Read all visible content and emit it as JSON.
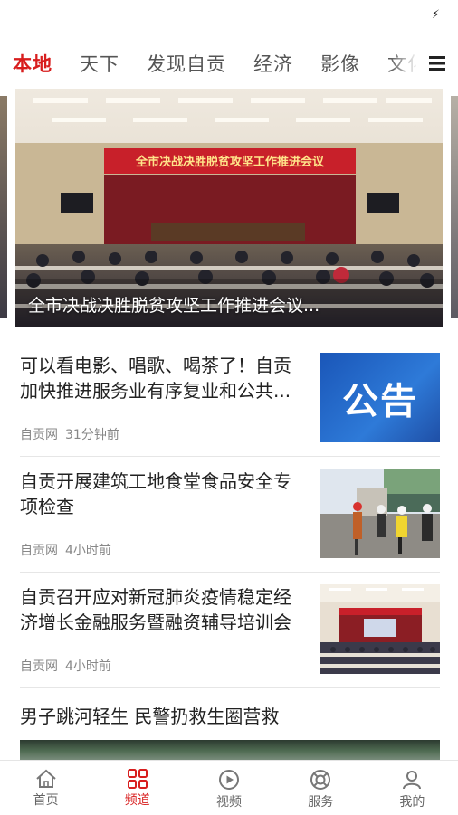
{
  "status_bar": {
    "charging_icon": "lightning-bolt-icon"
  },
  "tabs": {
    "items": [
      {
        "label": "本地",
        "active": true
      },
      {
        "label": "天下",
        "active": false
      },
      {
        "label": "发现自贡",
        "active": false
      },
      {
        "label": "经济",
        "active": false
      },
      {
        "label": "影像",
        "active": false
      },
      {
        "label": "文化",
        "active": false
      }
    ],
    "menu_icon": "hamburger-menu-icon",
    "accent_color": "#d81e1e"
  },
  "banner": {
    "caption": "全市决战决胜脱贫攻坚工作推进会议...",
    "stage_sign": "全市决战决胜脱贫攻坚工作推进会议"
  },
  "news": [
    {
      "title": "可以看电影、唱歌、喝茶了！自贡加快推进服务业有序复业和公共...",
      "source": "自贡网",
      "time": "31分钟前",
      "thumb_text": "公告"
    },
    {
      "title": "自贡开展建筑工地食堂食品安全专项检查",
      "source": "自贡网",
      "time": "4小时前"
    },
    {
      "title": "自贡召开应对新冠肺炎疫情稳定经济增长金融服务暨融资辅导培训会",
      "source": "自贡网",
      "time": "4小时前"
    },
    {
      "title": "男子跳河轻生 民警扔救生圈营救"
    }
  ],
  "bottom_nav": {
    "items": [
      {
        "label": "首页",
        "icon": "home-icon",
        "active": false
      },
      {
        "label": "频道",
        "icon": "grid-icon",
        "active": true
      },
      {
        "label": "视频",
        "icon": "play-icon",
        "active": false
      },
      {
        "label": "服务",
        "icon": "lifebuoy-icon",
        "active": false
      },
      {
        "label": "我的",
        "icon": "user-icon",
        "active": false
      }
    ]
  }
}
